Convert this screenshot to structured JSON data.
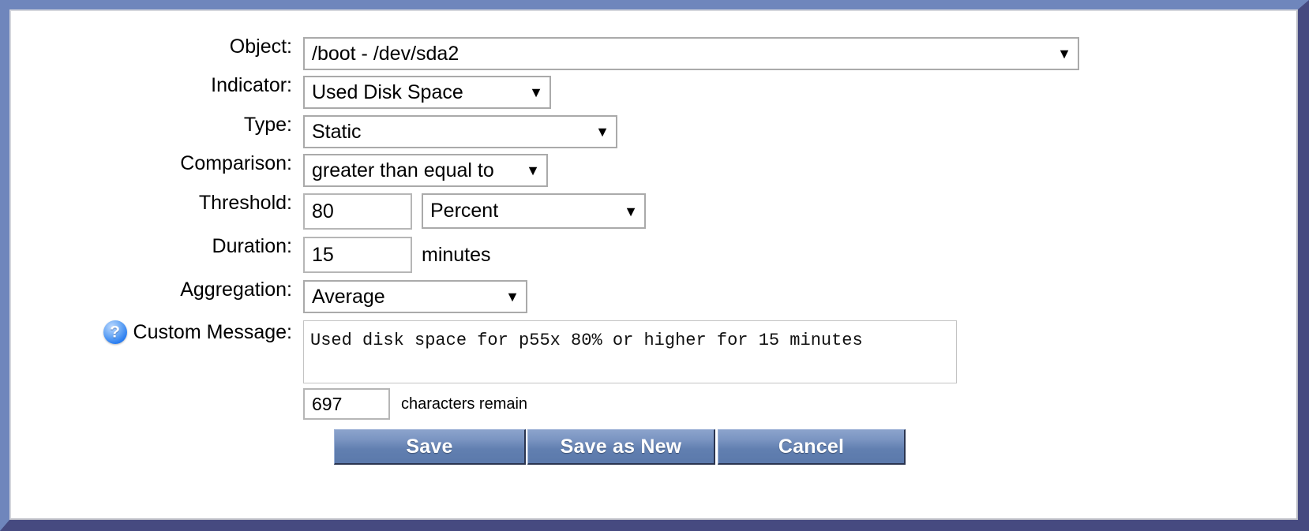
{
  "window": {
    "frame_light": "#6f86bc",
    "frame_dark": "#464a80"
  },
  "form": {
    "rows": [
      {
        "label": "Object:",
        "value": "/boot - /dev/sda2",
        "control": "select"
      },
      {
        "label": "Indicator:",
        "value": "Used Disk Space",
        "control": "select"
      },
      {
        "label": "Type:",
        "value": "Static",
        "control": "select"
      },
      {
        "label": "Comparison:",
        "value": "greater than equal to",
        "control": "select"
      },
      {
        "label": "Threshold:",
        "value": "80",
        "control": "input",
        "unit": "Percent"
      },
      {
        "label": "Duration:",
        "value": "15",
        "control": "input",
        "suffix": "minutes"
      },
      {
        "label": "Aggregation:",
        "value": "Average",
        "control": "select"
      },
      {
        "label": "Custom Message:",
        "value": "Used disk space for p55x 80% or higher for 15 minutes",
        "control": "textarea"
      }
    ],
    "help_icon": "help-question-icon",
    "caret_glyph": "▼",
    "characters": {
      "remaining": "697",
      "label": "characters remain"
    }
  },
  "buttons": {
    "save": "Save",
    "save_as_new": "Save as New",
    "cancel": "Cancel",
    "face_color": "#6a85b6",
    "text_color": "#ffffff"
  }
}
